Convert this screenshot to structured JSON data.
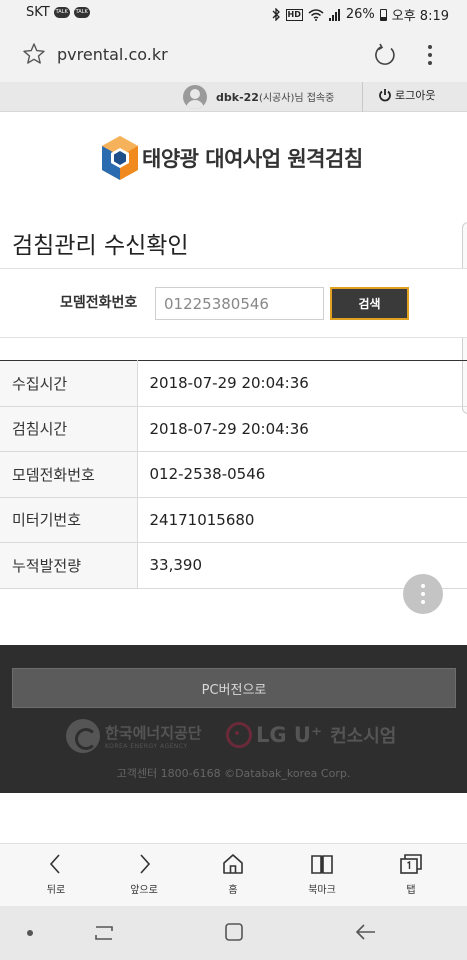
{
  "status_bar": {
    "carrier": "SKT",
    "talk_badge": "TALK",
    "hd_badge": "HD",
    "battery": "26%",
    "time": "오후 8:19"
  },
  "browser": {
    "url": "pvrental.co.kr"
  },
  "user_bar": {
    "username": "dbk-22",
    "role_suffix": "(시공사)님 접속중",
    "logout_label": "로그아웃"
  },
  "logo": {
    "title": "태양광 대여사업 원격검침"
  },
  "page": {
    "title": "검침관리 수신확인"
  },
  "search": {
    "label": "모뎀전화번호",
    "value": "01225380546",
    "button_label": "검색"
  },
  "table": {
    "rows": [
      {
        "label": "수집시간",
        "value": "2018-07-29 20:04:36"
      },
      {
        "label": "검침시간",
        "value": "2018-07-29 20:04:36"
      },
      {
        "label": "모뎀전화번호",
        "value": "012-2538-0546"
      },
      {
        "label": "미터기번호",
        "value": "24171015680"
      },
      {
        "label": "누적발전량",
        "value": "33,390"
      }
    ]
  },
  "footer": {
    "pc_button": "PC버전으로",
    "kea_name": "한국에너지공단",
    "kea_english": "KOREA ENERGY AGENCY",
    "lgu_name": "LG U⁺",
    "consortium": "컨소시엄",
    "copyright": "고객센터 1800-6168 ©Databak_korea Corp."
  },
  "bottom_nav": [
    {
      "label": "뒤로",
      "icon": "back-icon"
    },
    {
      "label": "앞으로",
      "icon": "forward-icon"
    },
    {
      "label": "홈",
      "icon": "home-icon"
    },
    {
      "label": "북마크",
      "icon": "bookmark-icon"
    },
    {
      "label": "탭",
      "icon": "tabs-icon"
    }
  ],
  "colors": {
    "search_button_bg": "#3a3a3a",
    "search_button_border": "#e0a020",
    "footer_bg": "#2e2e2e",
    "logo_orange": "#f08a1e",
    "logo_blue": "#2b6cb0"
  }
}
